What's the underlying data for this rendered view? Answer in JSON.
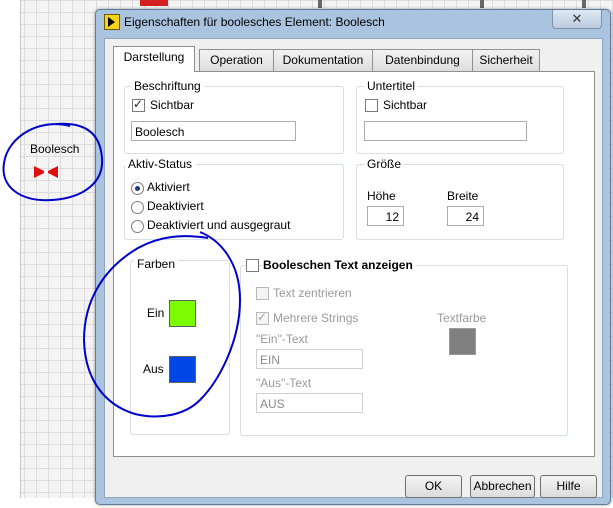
{
  "background": {
    "front_panel_label": "Boolesch"
  },
  "dialog": {
    "title": "Eigenschaften für boolesches Element: Boolesch",
    "close_glyph": "✕",
    "tabs": [
      {
        "label": "Darstellung",
        "active": true
      },
      {
        "label": "Operation",
        "active": false
      },
      {
        "label": "Dokumentation",
        "active": false
      },
      {
        "label": "Datenbindung",
        "active": false
      },
      {
        "label": "Sicherheit",
        "active": false
      }
    ],
    "label_group": {
      "title": "Beschriftung",
      "visible_label": "Sichtbar",
      "visible_checked": true,
      "value": "Boolesch"
    },
    "caption_group": {
      "title": "Untertitel",
      "visible_label": "Sichtbar",
      "visible_checked": false,
      "value": ""
    },
    "state_group": {
      "title": "Aktiv-Status",
      "options": [
        {
          "label": "Aktiviert",
          "selected": true
        },
        {
          "label": "Deaktiviert",
          "selected": false
        },
        {
          "label": "Deaktiviert und ausgegraut",
          "selected": false
        }
      ]
    },
    "size_group": {
      "title": "Größe",
      "height_label": "Höhe",
      "height_value": "12",
      "width_label": "Breite",
      "width_value": "24"
    },
    "colors_group": {
      "title": "Farben",
      "on_label": "Ein",
      "off_label": "Aus",
      "on_color": "#7cfc00",
      "off_color": "#0046e6"
    },
    "bool_text": {
      "show_label": "Booleschen Text anzeigen",
      "show_checked": false,
      "center_label": "Text zentrieren",
      "multi_label": "Mehrere Strings",
      "multi_checked": true,
      "on_text_label": "\"Ein\"-Text",
      "on_text_value": "EIN",
      "off_text_label": "\"Aus\"-Text",
      "off_text_value": "AUS",
      "text_color_label": "Textfarbe",
      "text_color": "#808080"
    },
    "buttons": {
      "ok": "OK",
      "cancel": "Abbrechen",
      "help": "Hilfe"
    }
  },
  "colors": {
    "annotation": "#0000cc",
    "dialog_frame": "#aac3de"
  }
}
